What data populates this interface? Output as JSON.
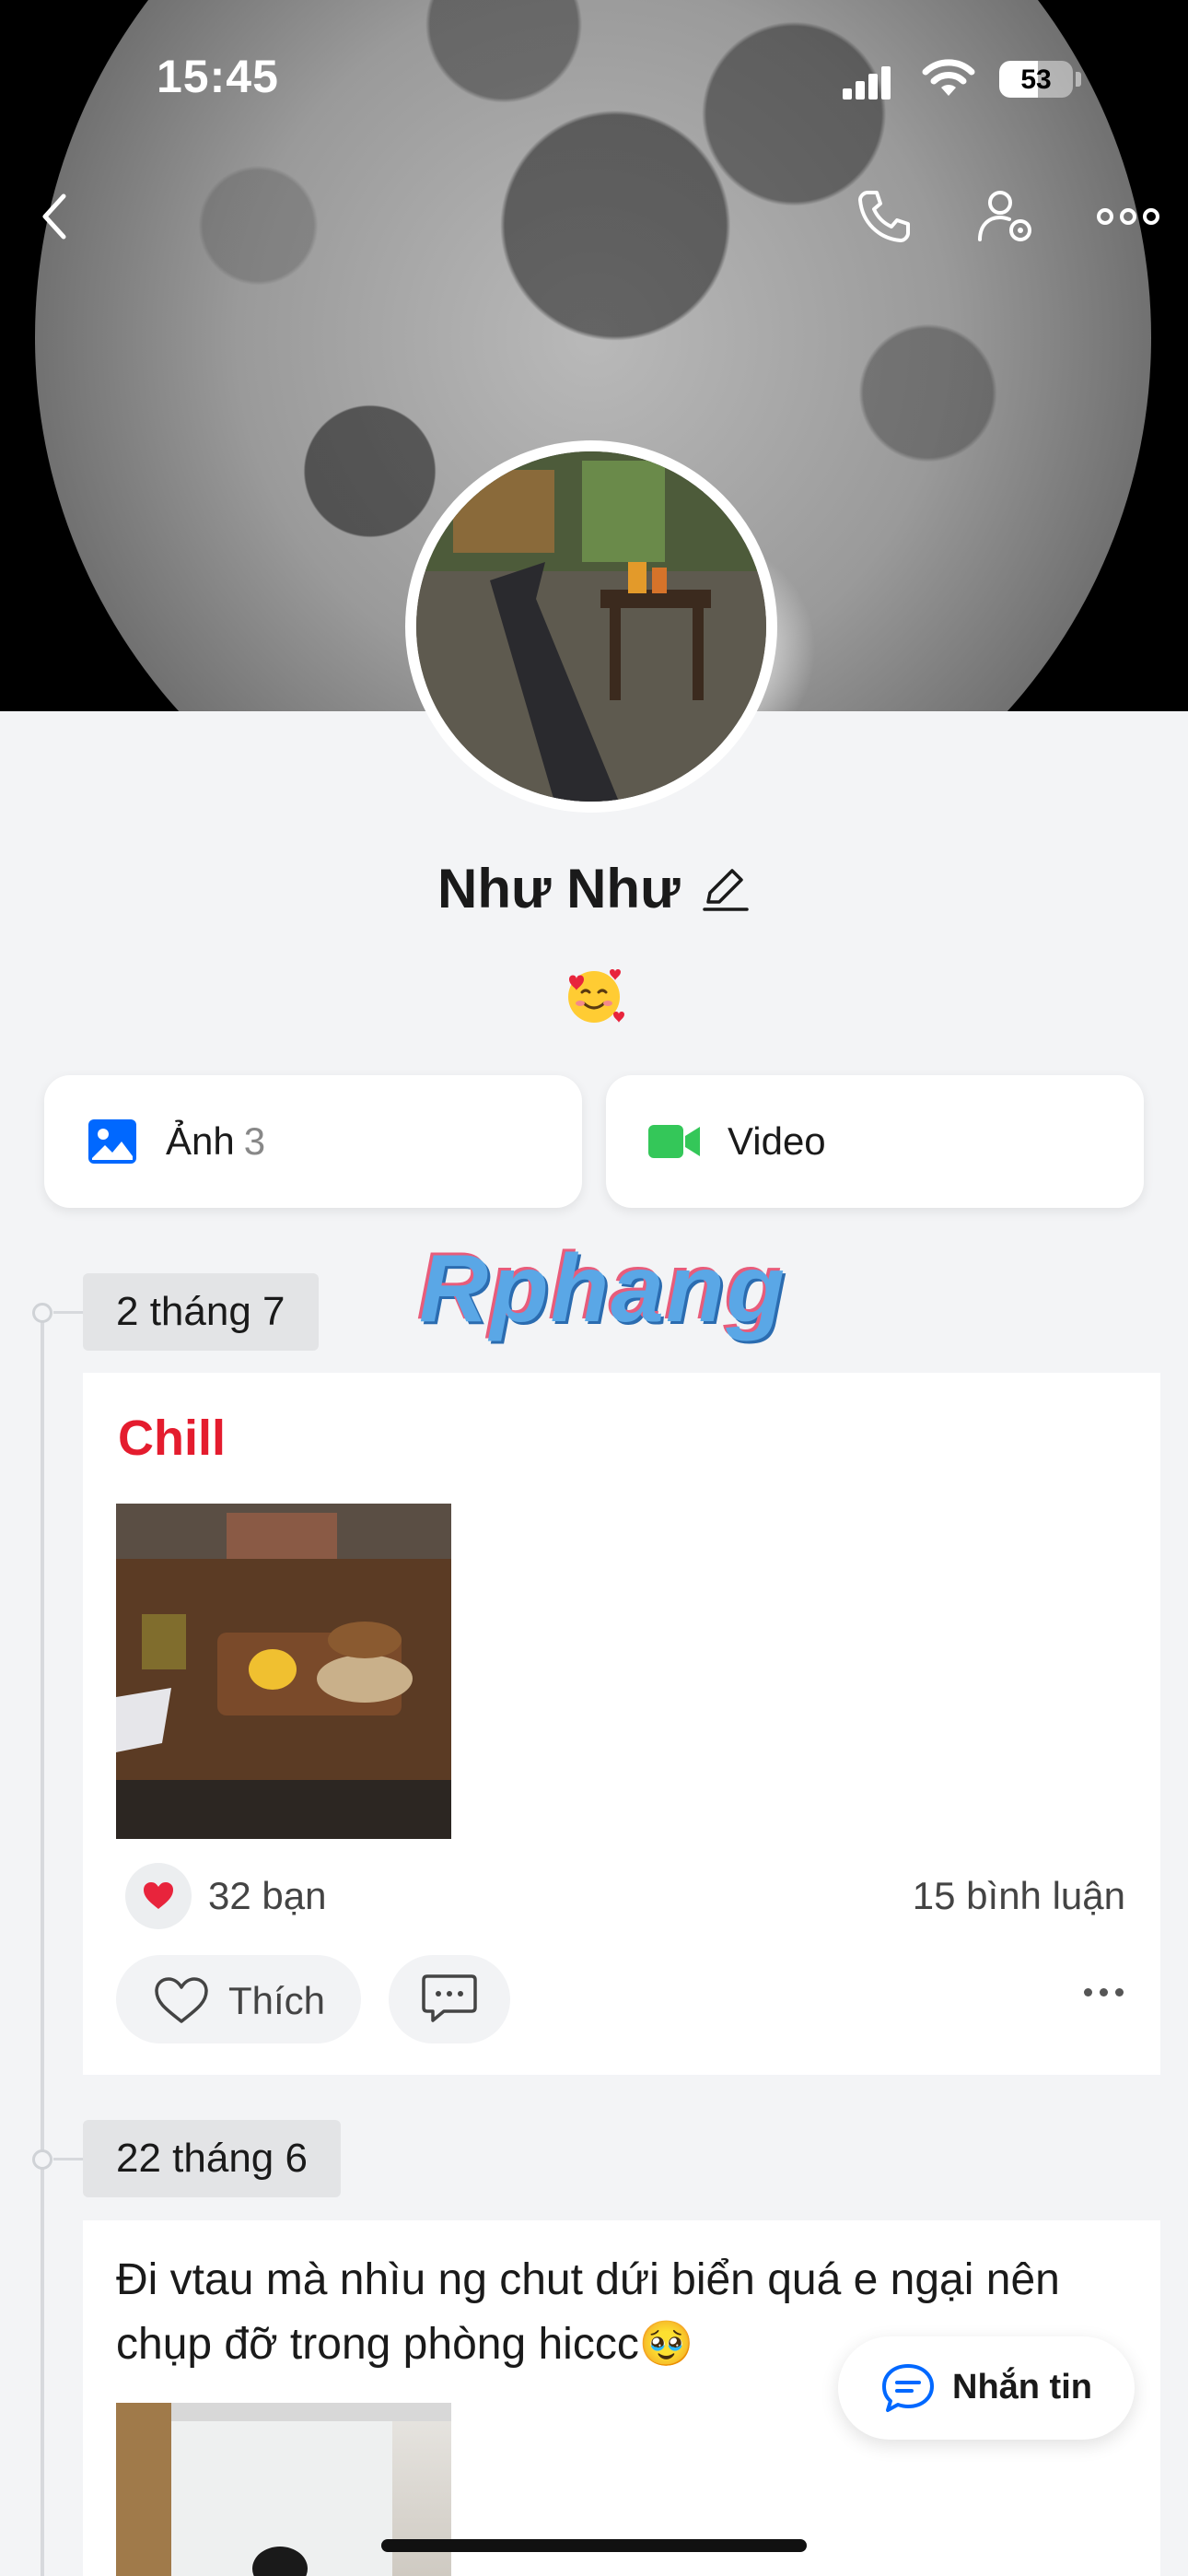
{
  "status_bar": {
    "time": "15:45",
    "battery": "53",
    "battery_level": 0.53
  },
  "profile": {
    "name": "Như Như",
    "status_emoji": "🥰"
  },
  "media": [
    {
      "label": "Ảnh",
      "count": "3"
    },
    {
      "label": "Video",
      "count": ""
    }
  ],
  "watermark": "Rphang",
  "posts": [
    {
      "date": "2 tháng 7",
      "title": "Chill",
      "reactions": "32 bạn",
      "comments": "15 bình luận",
      "like_label": "Thích"
    },
    {
      "date": "22 tháng 6",
      "text": "Đi vtau mà nhìu ng chut dứi biển quá e ngại nên chụp đỡ trong phòng hiccc🥹"
    }
  ],
  "fab": {
    "label": "Nhắn tin"
  },
  "colors": {
    "accent": "#0068ff",
    "title_red": "#e41c2e",
    "video_green": "#34c759"
  }
}
